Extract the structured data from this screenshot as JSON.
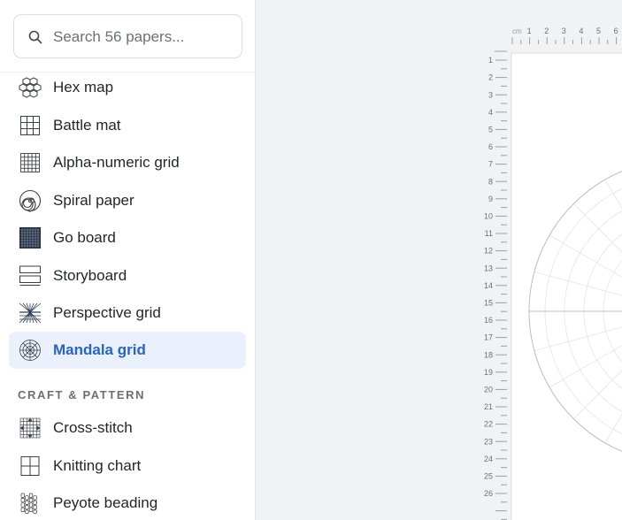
{
  "search": {
    "placeholder": "Search 56 papers..."
  },
  "sidebar": {
    "items_top": [
      {
        "label": "Hex map",
        "icon": "hex-map-icon"
      },
      {
        "label": "Battle mat",
        "icon": "battle-mat-icon"
      },
      {
        "label": "Alpha-numeric grid",
        "icon": "alpha-numeric-grid-icon"
      },
      {
        "label": "Spiral paper",
        "icon": "spiral-icon"
      },
      {
        "label": "Go board",
        "icon": "go-board-icon"
      },
      {
        "label": "Storyboard",
        "icon": "storyboard-icon"
      },
      {
        "label": "Perspective grid",
        "icon": "perspective-grid-icon"
      },
      {
        "label": "Mandala grid",
        "icon": "mandala-grid-icon",
        "active": true
      }
    ],
    "section_craft": "CRAFT & PATTERN",
    "items_craft": [
      {
        "label": "Cross-stitch",
        "icon": "cross-stitch-icon"
      },
      {
        "label": "Knitting chart",
        "icon": "knitting-chart-icon"
      },
      {
        "label": "Peyote beading",
        "icon": "peyote-beading-icon"
      }
    ]
  },
  "ruler": {
    "unit": "cm",
    "top_labels": [
      "1",
      "2",
      "3",
      "4",
      "5",
      "6"
    ],
    "left_labels": [
      "1",
      "2",
      "3",
      "4",
      "5",
      "6",
      "7",
      "8",
      "9",
      "10",
      "11",
      "12",
      "13",
      "14",
      "15",
      "16",
      "17",
      "18",
      "19",
      "20",
      "21",
      "22",
      "23",
      "24",
      "25",
      "26"
    ]
  },
  "colors": {
    "accent": "#2a64c4",
    "active_bg": "#eaf1fc"
  }
}
